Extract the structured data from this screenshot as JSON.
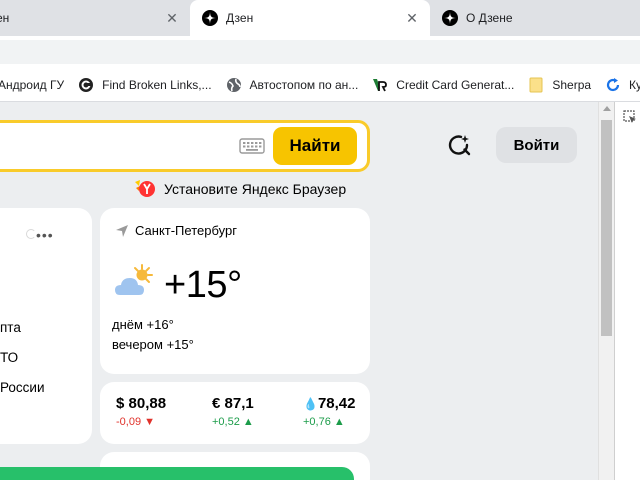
{
  "browser": {
    "tabs": [
      {
        "title": "ен",
        "active": false
      },
      {
        "title": "Дзен",
        "active": true
      },
      {
        "title": "О Дзене",
        "active": false
      }
    ],
    "bookmarks": [
      {
        "label": "Андроид ГУ",
        "icon": "none"
      },
      {
        "label": "Find Broken Links,...",
        "icon": "broken-links-icon"
      },
      {
        "label": "Автостопом по ан...",
        "icon": "globe-icon"
      },
      {
        "label": "Credit Card Generat...",
        "icon": "credit-card-generator-icon"
      },
      {
        "label": "Sherpa",
        "icon": "folder-icon"
      },
      {
        "label": "Куп",
        "icon": "refresh-icon"
      }
    ]
  },
  "page": {
    "search": {
      "button_label": "Найти",
      "accent": "#f7c400"
    },
    "login_label": "Войти",
    "promo_text": "Установите Яндекс Браузер",
    "news": {
      "items": [
        "пта",
        "ТО",
        "России"
      ]
    },
    "weather": {
      "city": "Санкт-Петербург",
      "temp_now": "+15°",
      "day": "днём +16°",
      "evening": "вечером +15°",
      "icon": "partly-cloudy-icon"
    },
    "rates": [
      {
        "name": "usd",
        "value": "$ 80,88",
        "change": "-0,09",
        "direction": "down"
      },
      {
        "name": "eur",
        "value": "€ 87,1",
        "change": "+0,52",
        "direction": "up"
      },
      {
        "name": "oil",
        "value": "78,42",
        "change": "+0,76",
        "direction": "up"
      }
    ]
  },
  "colors": {
    "down": "#e0322b",
    "up": "#1c9c4a",
    "search_border": "#f9cb2a"
  }
}
